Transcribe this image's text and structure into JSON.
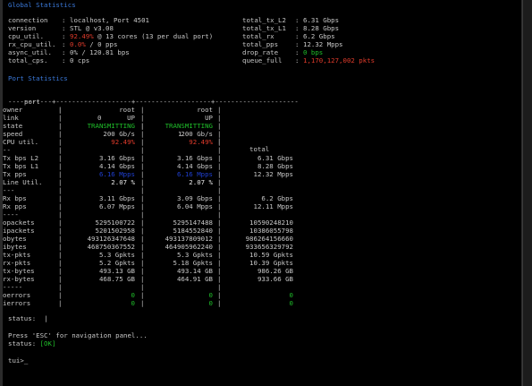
{
  "colors": {
    "heading": "#3a78d8",
    "ok": "#1fbf2a",
    "warn": "#e03b2b",
    "pps": "#1f3fd0",
    "text": "#c8c8c8"
  },
  "global": {
    "title": "Global Statistics",
    "left": [
      {
        "label": "connection",
        "sep": ":",
        "value": "localhost, Port 4501"
      },
      {
        "label": "version",
        "sep": ":",
        "value": "STL @ v3.08"
      },
      {
        "label": "cpu_util.",
        "sep": ":",
        "value_hl": "92.49%",
        "value": " @ 13 cores (13 per dual port)"
      },
      {
        "label": "rx_cpu_util.",
        "sep": ":",
        "value_hl": "0.0%",
        "value": " / 0 pps"
      },
      {
        "label": "async_util.",
        "sep": ":",
        "value": "0% / 120.81 bps"
      },
      {
        "label": "total_cps.",
        "sep": ":",
        "value": "0 cps"
      }
    ],
    "right": [
      {
        "label": "total_tx_L2",
        "sep": ":",
        "value": "6.31 Gbps"
      },
      {
        "label": "total_tx_L1",
        "sep": ":",
        "value": "8.28 Gbps"
      },
      {
        "label": "total_rx",
        "sep": ":",
        "value": "6.2 Gbps"
      },
      {
        "label": "total_pps",
        "sep": ":",
        "value": "12.32 Mpps"
      },
      {
        "label": "drop_rate",
        "sep": ":",
        "value": "0 bps"
      },
      {
        "label": "queue_full",
        "sep": ":",
        "value": "1,170,127,002 pkts"
      }
    ]
  },
  "port": {
    "title": "Port Statistics",
    "headers": [
      "port",
      "0",
      "1",
      "total"
    ],
    "divider": "-----------+-------------------+-------------------+---------------------",
    "rows": [
      {
        "label": "owner",
        "p0": "root",
        "p1": "root",
        "total": ""
      },
      {
        "label": "link",
        "p0": "UP",
        "p1": "UP",
        "total": ""
      },
      {
        "label": "state",
        "p0": "TRANSMITTING",
        "p1": "TRANSMITTING",
        "total": "",
        "color": "green"
      },
      {
        "label": "speed",
        "p0": "200 Gb/s",
        "p1": "200 Gb/s",
        "total": ""
      },
      {
        "label": "CPU util.",
        "p0": "92.49%",
        "p1": "92.49%",
        "total": "",
        "color": "red"
      },
      {
        "label": "--",
        "p0": "",
        "p1": "",
        "total": ""
      },
      {
        "label": "Tx bps L2",
        "p0": "3.16 Gbps",
        "p1": "3.16 Gbps",
        "total": "6.31 Gbps"
      },
      {
        "label": "Tx bps L1",
        "p0": "4.14 Gbps",
        "p1": "4.14 Gbps",
        "total": "8.28 Gbps"
      },
      {
        "label": "Tx pps",
        "p0": "6.16 Mpps",
        "p1": "6.16 Mpps",
        "total": "12.32 Mpps",
        "color": "dblue"
      },
      {
        "label": "Line Util.",
        "p0": "2.07 %",
        "p1": "2.07 %",
        "total": "",
        "color": "white"
      },
      {
        "label": "---",
        "p0": "",
        "p1": "",
        "total": ""
      },
      {
        "label": "Rx bps",
        "p0": "3.11 Gbps",
        "p1": "3.09 Gbps",
        "total": "6.2 Gbps"
      },
      {
        "label": "Rx pps",
        "p0": "6.07 Mpps",
        "p1": "6.04 Mpps",
        "total": "12.11 Mpps"
      },
      {
        "label": "----",
        "p0": "",
        "p1": "",
        "total": ""
      },
      {
        "label": "opackets",
        "p0": "5295100722",
        "p1": "5295147488",
        "total": "10590248210"
      },
      {
        "label": "ipackets",
        "p0": "5201502958",
        "p1": "5184552840",
        "total": "10386055798"
      },
      {
        "label": "obytes",
        "p0": "493126347648",
        "p1": "493137809012",
        "total": "986264156660"
      },
      {
        "label": "ibytes",
        "p0": "468750367552",
        "p1": "464905962240",
        "total": "933656329792"
      },
      {
        "label": "tx-pkts",
        "p0": "5.3 Gpkts",
        "p1": "5.3 Gpkts",
        "total": "10.59 Gpkts"
      },
      {
        "label": "rx-pkts",
        "p0": "5.2 Gpkts",
        "p1": "5.18 Gpkts",
        "total": "10.39 Gpkts"
      },
      {
        "label": "tx-bytes",
        "p0": "493.13 GB",
        "p1": "493.14 GB",
        "total": "986.26 GB"
      },
      {
        "label": "rx-bytes",
        "p0": "468.75 GB",
        "p1": "464.91 GB",
        "total": "933.66 GB"
      },
      {
        "label": "-----",
        "p0": "",
        "p1": "",
        "total": ""
      },
      {
        "label": "oerrors",
        "p0": "0",
        "p1": "0",
        "total": "0",
        "color": "green"
      },
      {
        "label": "ierrors",
        "p0": "0",
        "p1": "0",
        "total": "0",
        "color": "green"
      }
    ]
  },
  "status_line": {
    "label": "status:",
    "cursor": "|"
  },
  "help": {
    "line": "Press 'ESC' for navigation panel...",
    "status_label": "status:",
    "status_value": "[OK]"
  },
  "prompt": {
    "text": "tui>",
    "cursor": "_"
  }
}
